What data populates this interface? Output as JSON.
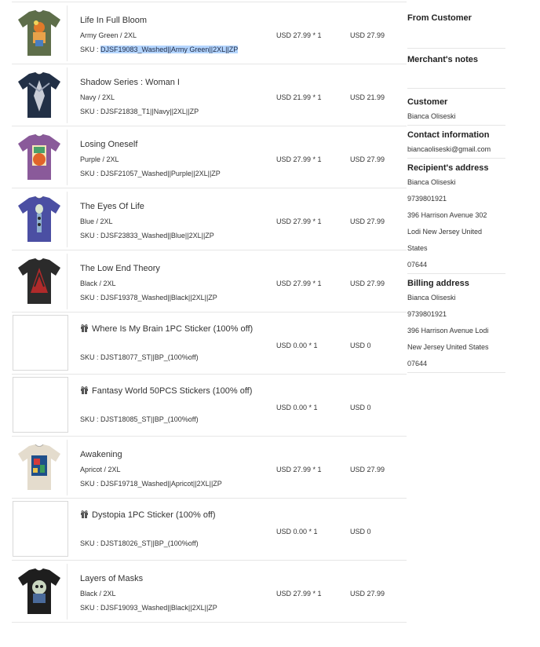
{
  "items": [
    {
      "name": "Life In Full Bloom",
      "variant": "Army Green / 2XL",
      "sku_label": "SKU : ",
      "sku": "DJSF19083_Washed||Army Green||2XL||ZP",
      "qty": "USD 27.99 * 1",
      "total": "USD 27.99",
      "shirt_color": "#5e6e4a",
      "art": "bloom"
    },
    {
      "name": "Shadow Series : Woman I",
      "variant": "Navy / 2XL",
      "sku_label": "SKU : ",
      "sku": "DJSF21838_T1||Navy||2XL||ZP",
      "qty": "USD 21.99 * 1",
      "total": "USD 21.99",
      "shirt_color": "#223046",
      "art": "shadow"
    },
    {
      "name": "Losing Oneself",
      "variant": "Purple / 2XL",
      "sku_label": "SKU : ",
      "sku": "DJSF21057_Washed||Purple||2XL||ZP",
      "qty": "USD 27.99 * 1",
      "total": "USD 27.99",
      "shirt_color": "#8a5a9a",
      "art": "losing"
    },
    {
      "name": "The Eyes Of Life",
      "variant": "Blue / 2XL",
      "sku_label": "SKU : ",
      "sku": "DJSF23833_Washed||Blue||2XL||ZP",
      "qty": "USD 27.99 * 1",
      "total": "USD 27.99",
      "shirt_color": "#4b4fa3",
      "art": "eyes"
    },
    {
      "name": "The Low End Theory",
      "variant": "Black / 2XL",
      "sku_label": "SKU : ",
      "sku": "DJSF19378_Washed||Black||2XL||ZP",
      "qty": "USD 27.99 * 1",
      "total": "USD 27.99",
      "shirt_color": "#2b2b2b",
      "art": "lowend"
    },
    {
      "name": "Where Is My Brain 1PC Sticker (100% off)",
      "gift": true,
      "sku_label": "SKU : ",
      "sku": "DJST18077_ST||BP_(100%off)",
      "qty": "USD 0.00 * 1",
      "total": "USD 0"
    },
    {
      "name": "Fantasy World 50PCS Stickers (100% off)",
      "gift": true,
      "sku_label": "SKU : ",
      "sku": "DJST18085_ST||BP_(100%off)",
      "qty": "USD 0.00 * 1",
      "total": "USD 0"
    },
    {
      "name": "Awakening",
      "variant": "Apricot / 2XL",
      "sku_label": "SKU : ",
      "sku": "DJSF19718_Washed||Apricot||2XL||ZP",
      "qty": "USD 27.99 * 1",
      "total": "USD 27.99",
      "shirt_color": "#e4dccd",
      "art": "awakening"
    },
    {
      "name": "Dystopia 1PC Sticker (100% off)",
      "gift": true,
      "sku_label": "SKU : ",
      "sku": "DJST18026_ST||BP_(100%off)",
      "qty": "USD 0.00 * 1",
      "total": "USD 0"
    },
    {
      "name": "Layers of Masks",
      "variant": "Black / 2XL",
      "sku_label": "SKU : ",
      "sku": "DJSF19093_Washed||Black||2XL||ZP",
      "qty": "USD 27.99 * 1",
      "total": "USD 27.99",
      "shirt_color": "#1e1e1e",
      "art": "masks"
    }
  ],
  "sidebar": {
    "from_customer": "From Customer",
    "merchant_notes": "Merchant's notes",
    "customer_title": "Customer",
    "customer_name": "Bianca Oliseski",
    "contact_title": "Contact information",
    "contact_email": "biancaoliseski@gmail.com",
    "recipient_title": "Recipient's address",
    "recipient_lines": [
      "Bianca Oliseski",
      "9739801921",
      "396 Harrison Avenue 302",
      "Lodi New Jersey United",
      "States",
      "07644"
    ],
    "billing_title": "Billing address",
    "billing_lines": [
      "Bianca Oliseski",
      "9739801921",
      "396 Harrison Avenue Lodi",
      "New Jersey United States",
      "07644"
    ]
  }
}
